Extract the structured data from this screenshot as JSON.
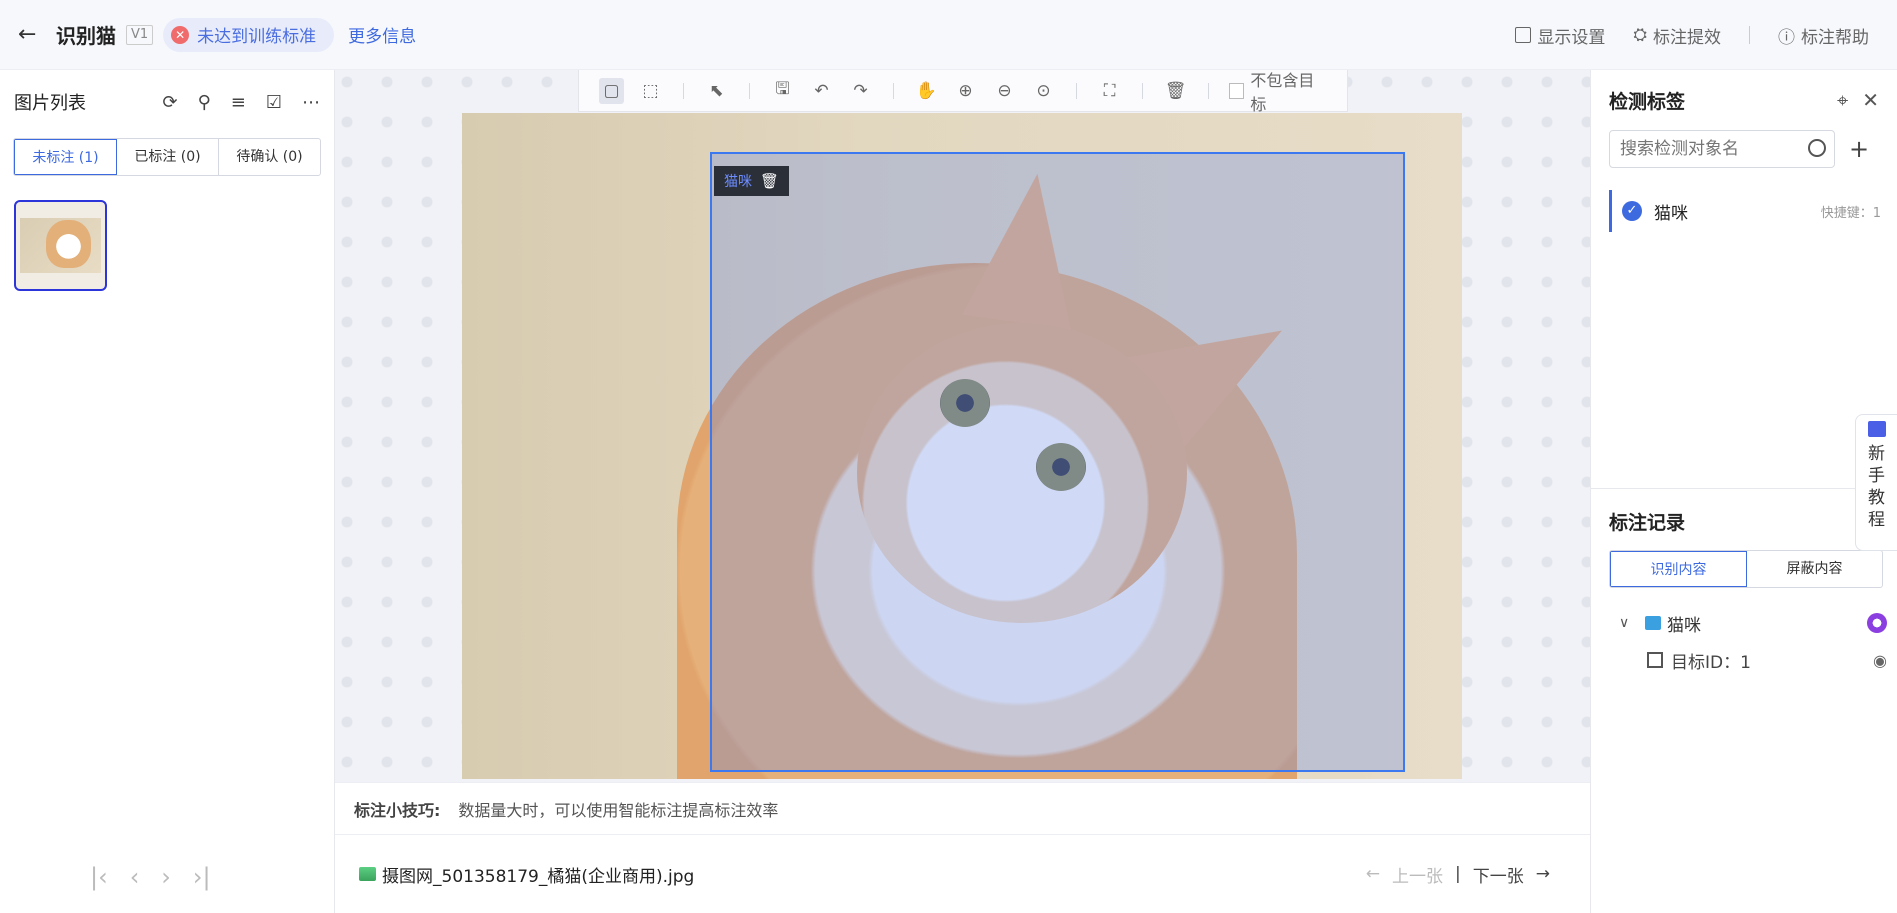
{
  "header": {
    "back_icon": "←",
    "title": "识别猫",
    "version": "V1",
    "status": "未达到训练标准",
    "more_info": "更多信息",
    "display_settings": "显示设置",
    "annotation_efficiency": "标注提效",
    "annotation_help": "标注帮助"
  },
  "sidebar": {
    "title": "图片列表",
    "tabs": [
      {
        "label": "未标注 (1)",
        "active": true
      },
      {
        "label": "已标注 (0)",
        "active": false
      },
      {
        "label": "待确认 (0)",
        "active": false
      }
    ]
  },
  "toolbar": {
    "no_target_label": "不包含目标"
  },
  "canvas": {
    "bbox_label": "猫咪",
    "tip_label": "标注小技巧:",
    "tip_text": "数据量大时，可以使用智能标注提高标注效率",
    "file_name": "摄图网_501358179_橘猫(企业商用).jpg",
    "prev": "上一张",
    "next": "下一张"
  },
  "right_panel": {
    "title": "检测标签",
    "search_placeholder": "搜索检测对象名",
    "label": {
      "name": "猫咪",
      "hotkey": "快捷键：1"
    },
    "record_title": "标注记录",
    "record_tabs": [
      {
        "label": "识别内容",
        "active": true
      },
      {
        "label": "屏蔽内容",
        "active": false
      }
    ],
    "tree": {
      "label": "猫咪",
      "target": "目标ID：1"
    }
  },
  "guide": {
    "chars": [
      "新",
      "手",
      "教",
      "程"
    ]
  },
  "colors": {
    "accent": "#3e6ae0",
    "bbox": "#3c78f0",
    "error": "#f06b6b"
  }
}
